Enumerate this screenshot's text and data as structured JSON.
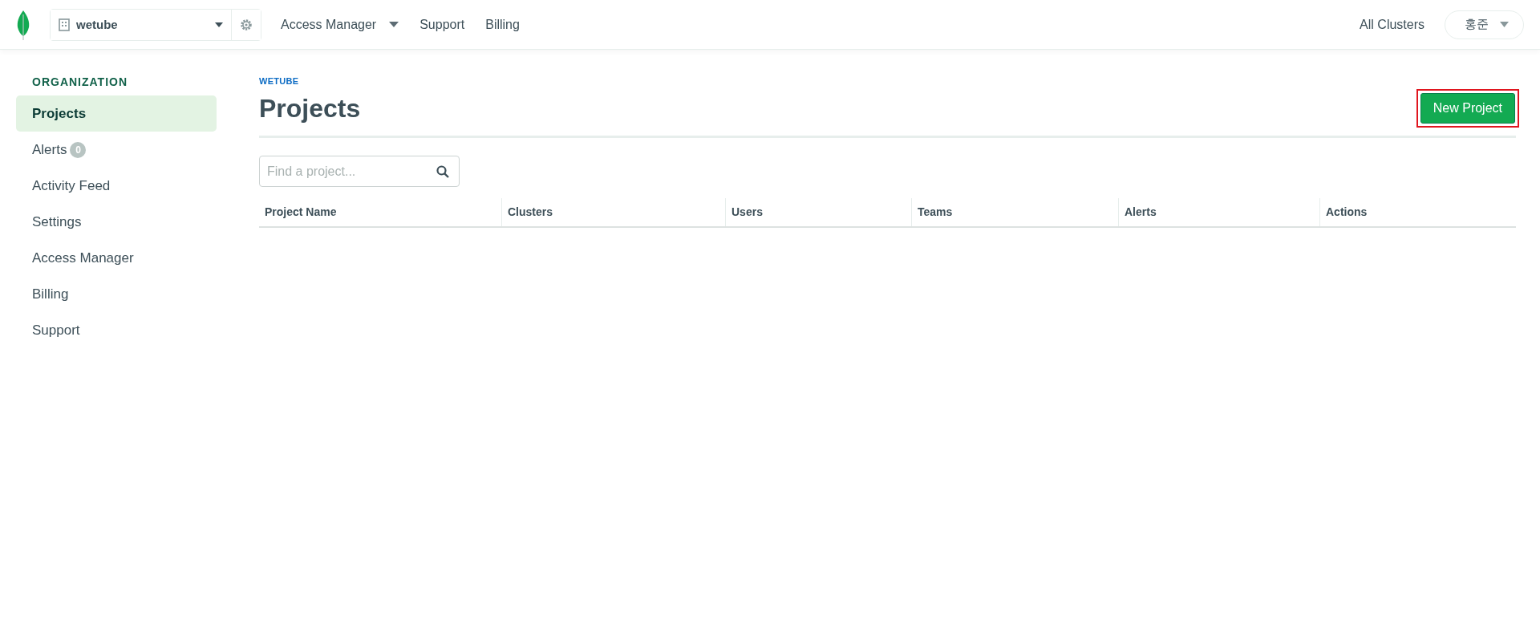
{
  "topbar": {
    "org_name": "wetube",
    "nav": [
      {
        "label": "Access Manager",
        "dropdown": true
      },
      {
        "label": "Support",
        "dropdown": false
      },
      {
        "label": "Billing",
        "dropdown": false
      }
    ],
    "all_clusters": "All Clusters",
    "user": "홍준"
  },
  "sidebar": {
    "heading": "ORGANIZATION",
    "items": [
      {
        "label": "Projects",
        "selected": true
      },
      {
        "label": "Alerts",
        "selected": false,
        "badge": "0"
      },
      {
        "label": "Activity Feed",
        "selected": false
      },
      {
        "label": "Settings",
        "selected": false
      },
      {
        "label": "Access Manager",
        "selected": false
      },
      {
        "label": "Billing",
        "selected": false
      },
      {
        "label": "Support",
        "selected": false
      }
    ]
  },
  "main": {
    "breadcrumb": "WETUBE",
    "title": "Projects",
    "new_button": {
      "label": "New Project",
      "highlighted": true
    },
    "search": {
      "placeholder": "Find a project..."
    },
    "table": {
      "columns": [
        "Project Name",
        "Clusters",
        "Users",
        "Teams",
        "Alerts",
        "Actions"
      ]
    }
  }
}
